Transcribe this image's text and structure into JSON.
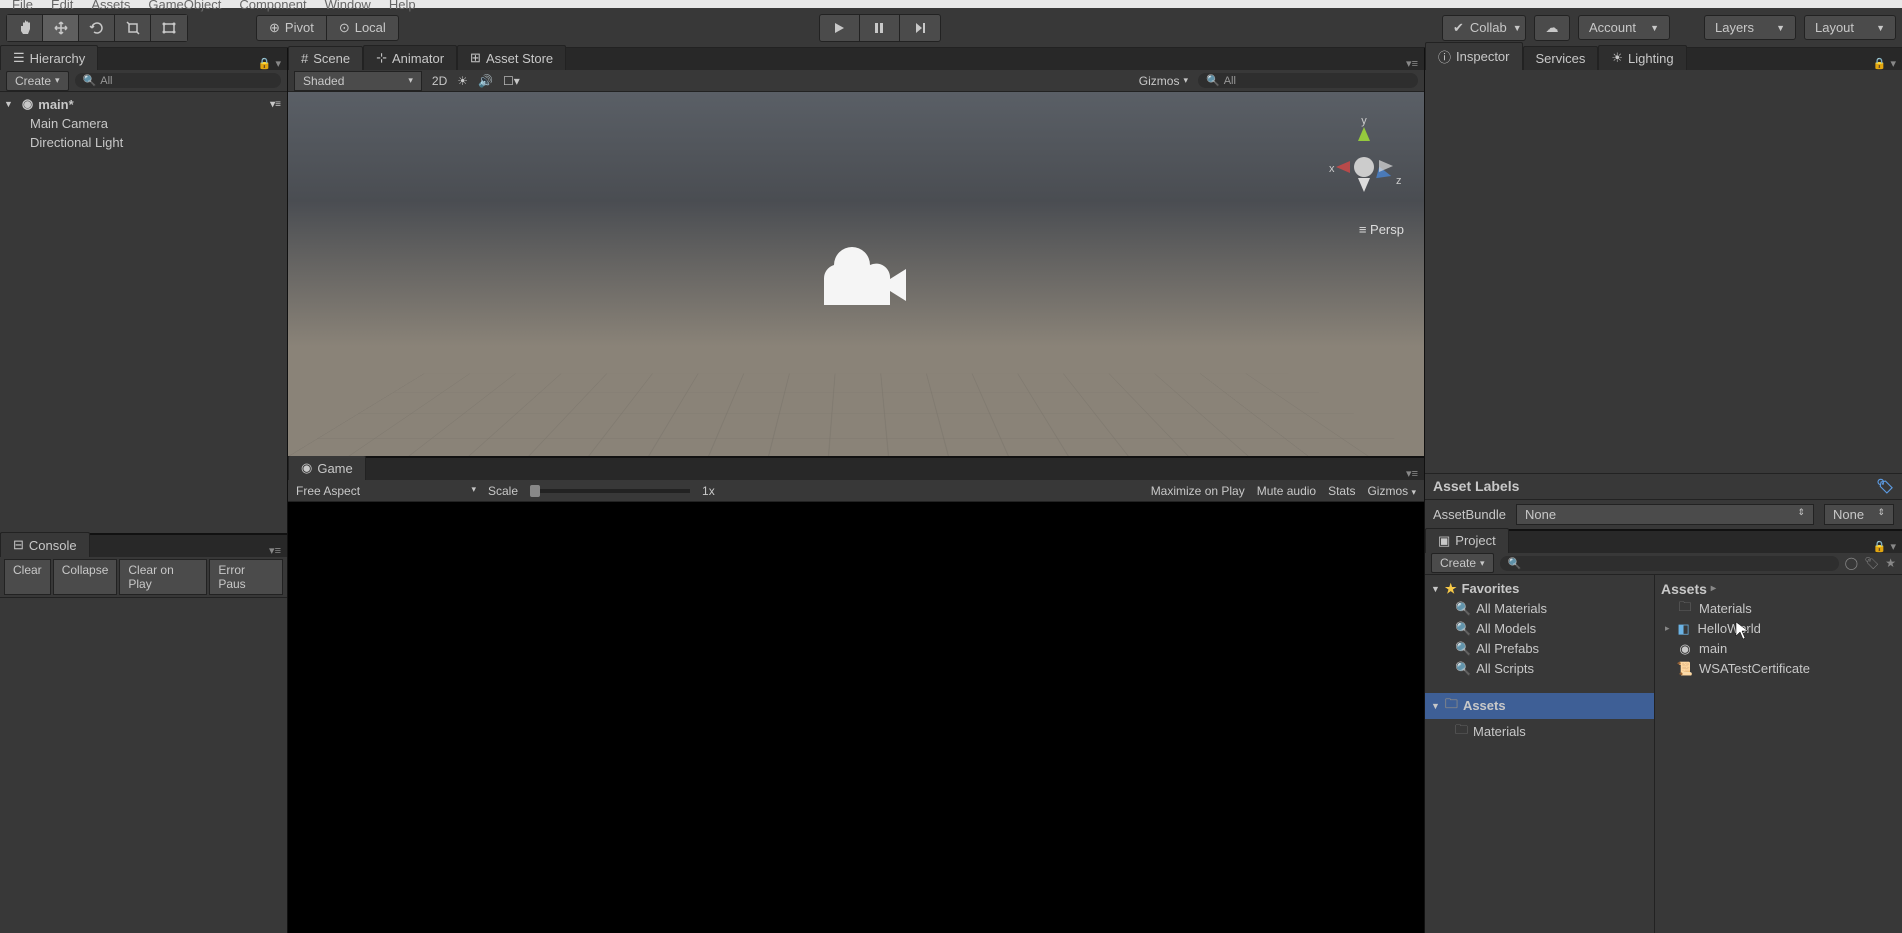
{
  "menubar": [
    "File",
    "Edit",
    "Assets",
    "GameObject",
    "Component",
    "Window",
    "Help"
  ],
  "toolbar": {
    "pivot": "Pivot",
    "local": "Local",
    "collab": "Collab",
    "account": "Account",
    "layers": "Layers",
    "layout": "Layout"
  },
  "hierarchy": {
    "title": "Hierarchy",
    "create": "Create",
    "search": "All",
    "scene": "main*",
    "items": [
      "Main Camera",
      "Directional Light"
    ]
  },
  "console": {
    "title": "Console",
    "clear": "Clear",
    "collapse": "Collapse",
    "clear_on_play": "Clear on Play",
    "error_pause": "Error Paus"
  },
  "scene": {
    "tab": "Scene",
    "animator": "Animator",
    "store": "Asset Store",
    "shaded": "Shaded",
    "twod": "2D",
    "gizmos": "Gizmos",
    "search": "All",
    "axis_x": "x",
    "axis_y": "y",
    "axis_z": "z",
    "persp": "Persp"
  },
  "game": {
    "tab": "Game",
    "free": "Free Aspect",
    "scale": "Scale",
    "scale_val": "1x",
    "max": "Maximize on Play",
    "mute": "Mute audio",
    "stats": "Stats",
    "gizmos": "Gizmos"
  },
  "inspector": {
    "tab": "Inspector",
    "services": "Services",
    "lighting": "Lighting",
    "labels": "Asset Labels",
    "bundle": "AssetBundle",
    "bundle_val": "None",
    "bundle_variant": "None"
  },
  "project": {
    "tab": "Project",
    "create": "Create",
    "favorites": "Favorites",
    "fav_items": [
      "All Materials",
      "All Models",
      "All Prefabs",
      "All Scripts"
    ],
    "assets": "Assets",
    "asset_folders": [
      "Materials"
    ],
    "crumb": "Assets",
    "content": [
      {
        "name": "Materials",
        "icon": "folder"
      },
      {
        "name": "HelloWorld",
        "icon": "prefab"
      },
      {
        "name": "main",
        "icon": "scene"
      },
      {
        "name": "WSATestCertificate",
        "icon": "cert"
      }
    ]
  }
}
